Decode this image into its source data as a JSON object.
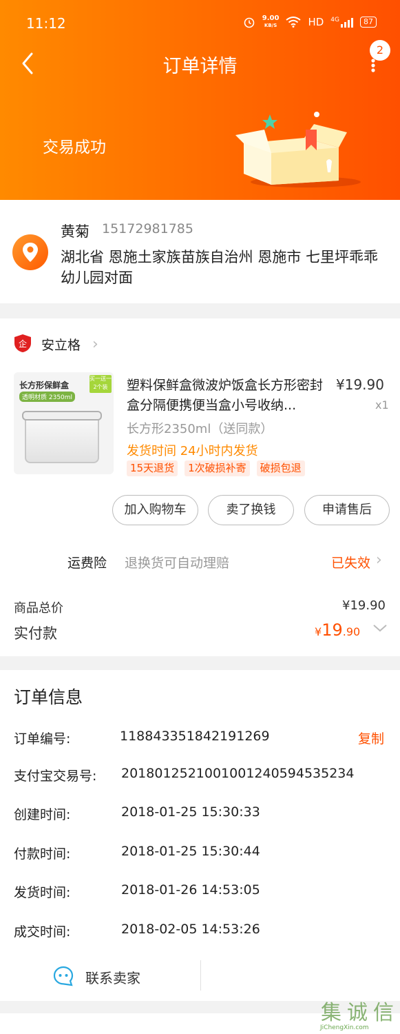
{
  "status_bar": {
    "time": "11:12",
    "speed_value": "9.00",
    "speed_unit": "KB/S",
    "hd": "HD",
    "network": "4G",
    "battery": "87"
  },
  "nav": {
    "title": "订单详情",
    "badge_count": "2"
  },
  "header": {
    "trade_status": "交易成功",
    "gradient_start": "#ff8a00",
    "gradient_end": "#ff5000"
  },
  "address": {
    "name": "黄菊",
    "phone": "15172981785",
    "text": "湖北省 恩施土家族苗族自治州 恩施市 七里坪乖乖幼儿园对面"
  },
  "shop": {
    "name": "安立格"
  },
  "product": {
    "image_label": "长方形保鲜盒",
    "image_tag": "买一送一 2个装",
    "image_sub": "透明材质 2350ml",
    "title": "塑料保鲜盒微波炉饭盒长方形密封盒分隔便携便当盒小号收纳...",
    "price": "¥19.90",
    "qty": "x1",
    "spec": "长方形2350ml（送同款）",
    "ship_time": "发货时间 24小时内发货",
    "tags": [
      "15天退货",
      "1次破损补寄",
      "破损包退"
    ]
  },
  "actions": {
    "add_cart": "加入购物车",
    "resell": "卖了换钱",
    "after_sale": "申请售后"
  },
  "insurance": {
    "label": "运费险",
    "desc": "退换货可自动理赔",
    "status": "已失效"
  },
  "totals": {
    "goods_total_label": "商品总价",
    "goods_total_value": "¥19.90",
    "paid_label": "实付款",
    "paid_currency": "¥",
    "paid_int": "19",
    "paid_dec": ".90"
  },
  "order_info": {
    "title": "订单信息",
    "copy_label": "复制",
    "rows": [
      {
        "label": "订单编号:",
        "value": "118843351842191269"
      },
      {
        "label": "支付宝交易号:",
        "value": "2018012521001001240594535234"
      },
      {
        "label": "创建时间:",
        "value": "2018-01-25 15:30:33"
      },
      {
        "label": "付款时间:",
        "value": "2018-01-25 15:30:44"
      },
      {
        "label": "发货时间:",
        "value": "2018-01-26 14:53:05"
      },
      {
        "label": "成交时间:",
        "value": "2018-02-05 14:53:26"
      }
    ]
  },
  "contact": {
    "label": "联系卖家"
  },
  "watermark": {
    "chars": [
      "集",
      "诚",
      "信"
    ],
    "text": "JiChengXin.com"
  },
  "colors": {
    "accent": "#ff5000",
    "ship_orange": "#ff8a00"
  }
}
